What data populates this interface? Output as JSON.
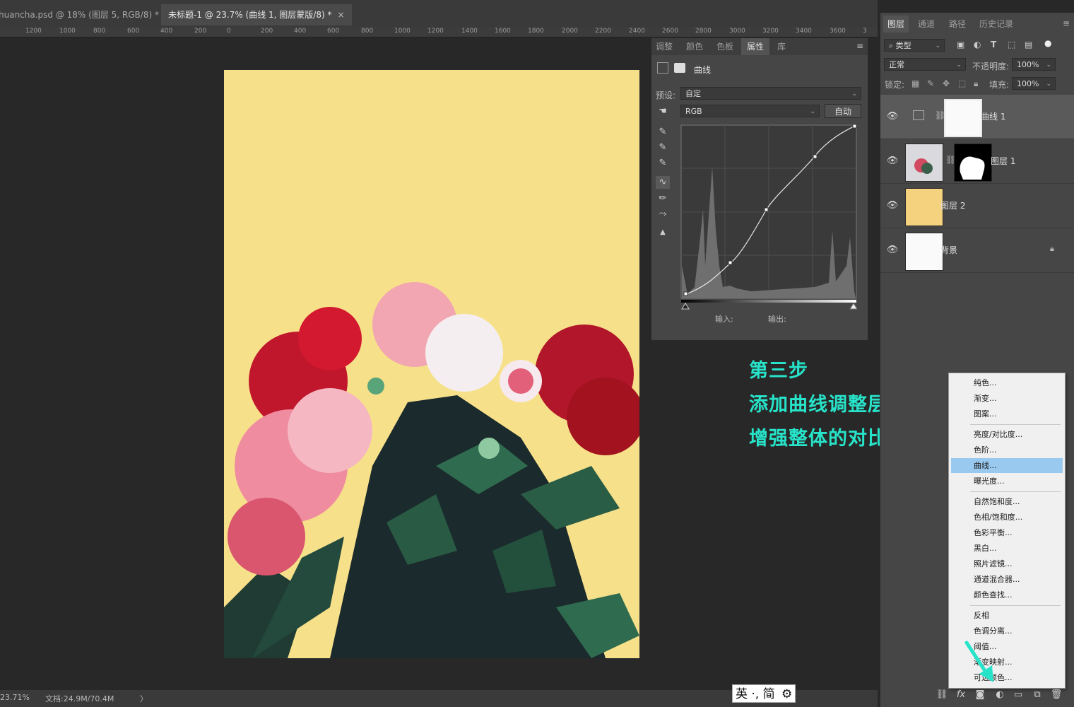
{
  "tabs": [
    {
      "label": "huancha.psd @ 18% (图层 5, RGB/8) *",
      "close": "×"
    },
    {
      "label": "未标题-1 @ 23.7% (曲线 1, 图层蒙版/8) *",
      "close": "×"
    }
  ],
  "ruler": {
    "labels": [
      "1200",
      "1000",
      "800",
      "600",
      "400",
      "200",
      "0",
      "200",
      "400",
      "600",
      "800",
      "1000",
      "1200",
      "1400",
      "1600",
      "1800",
      "2000",
      "2200",
      "2400",
      "2600",
      "2800",
      "3000",
      "3200",
      "3400",
      "3600",
      "3"
    ]
  },
  "status": {
    "zoom": "23.71%",
    "doc_info": "文档:24.9M/70.4M",
    "arrow": "〉"
  },
  "properties": {
    "tabs": [
      "调整",
      "颜色",
      "色板",
      "属性",
      "库"
    ],
    "active_tab": "属性",
    "panel_title": "曲线",
    "preset_label": "预设:",
    "preset_value": "自定",
    "channel": "RGB",
    "auto_button": "自动",
    "input_label": "输入:",
    "output_label": "输出:"
  },
  "annotation": {
    "line1": "第三步",
    "line2": "添加曲线调整层",
    "line3": "增强整体的对比度"
  },
  "layers_panel": {
    "tabs": [
      "图层",
      "通道",
      "路径",
      "历史记录"
    ],
    "active_tab": "图层",
    "filter_kind": "类型",
    "blend_mode": "正常",
    "opacity_label": "不透明度:",
    "opacity_value": "100%",
    "lock_label": "锁定:",
    "fill_label": "填充:",
    "fill_value": "100%",
    "layers": [
      {
        "name": "曲线 1",
        "active": true
      },
      {
        "name": "图层 1",
        "active": false
      },
      {
        "name": "图层 2",
        "active": false
      },
      {
        "name": "背景",
        "active": false
      }
    ]
  },
  "adjustment_menu": {
    "items": [
      "纯色...",
      "渐变...",
      "图案...",
      "亮度/对比度...",
      "色阶...",
      "曲线...",
      "曝光度...",
      "自然饱和度...",
      "色相/饱和度...",
      "色彩平衡...",
      "黑白...",
      "照片滤镜...",
      "通道混合器...",
      "颜色查找...",
      "反相",
      "色调分离...",
      "阈值...",
      "渐变映射...",
      "可选颜色..."
    ],
    "highlighted": "曲线..."
  },
  "ime": {
    "text": "英 ·, 简"
  },
  "colors": {
    "artboard": "#f7e08a",
    "accent_annotation": "#27e3c9",
    "menu_highlight": "#99c9ef",
    "layer2_fill": "#f5d27d"
  }
}
